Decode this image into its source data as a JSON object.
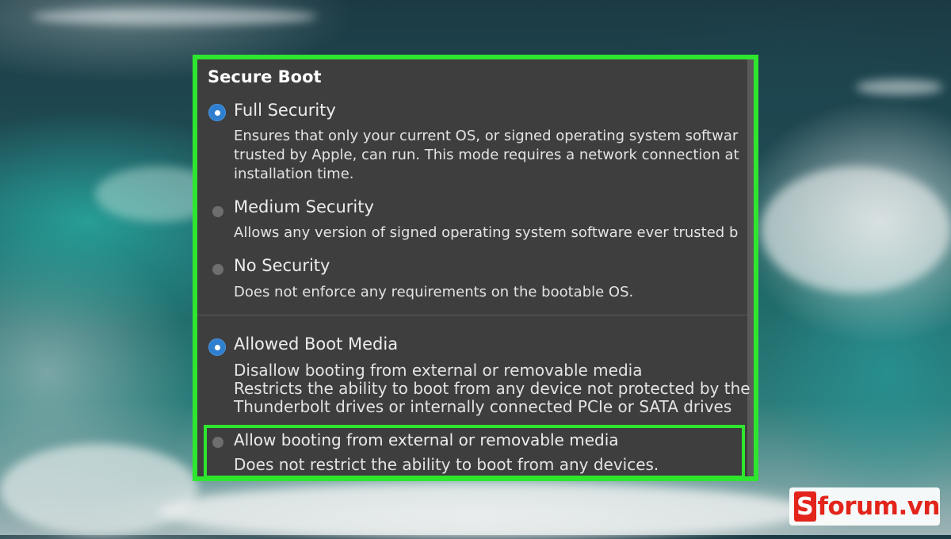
{
  "panel": {
    "title": "Secure Boot",
    "security_options": [
      {
        "label": "Full Security",
        "selected": true,
        "description_lines": [
          "Ensures that only your current OS, or signed operating system softwar",
          "trusted by Apple, can run. This mode requires a network connection at",
          "installation time."
        ]
      },
      {
        "label": "Medium Security",
        "selected": false,
        "description_lines": [
          "Allows any version of signed operating system software ever trusted b"
        ]
      },
      {
        "label": "No Security",
        "selected": false,
        "description_lines": [
          "Does not enforce any requirements on the bootable OS."
        ]
      }
    ],
    "boot_media_options": [
      {
        "label": "Allowed Boot Media",
        "selected": true,
        "description_lines": [
          "Disallow booting from external or removable media",
          "Restricts the ability to boot from any device not protected by the",
          "Thunderbolt drives or internally connected PCIe or SATA drives"
        ]
      },
      {
        "label": "Allow booting from external or removable media",
        "selected": false,
        "description_lines": [
          "Does not restrict the ability to boot from any devices."
        ]
      }
    ]
  },
  "watermark": {
    "mark": "S",
    "text": "forum.vn"
  },
  "colors": {
    "highlight": "#2ee62e",
    "panel_bg": "#3e3e3e",
    "radio_selected": "#2f7fd0",
    "brand_red": "#e3241b"
  }
}
